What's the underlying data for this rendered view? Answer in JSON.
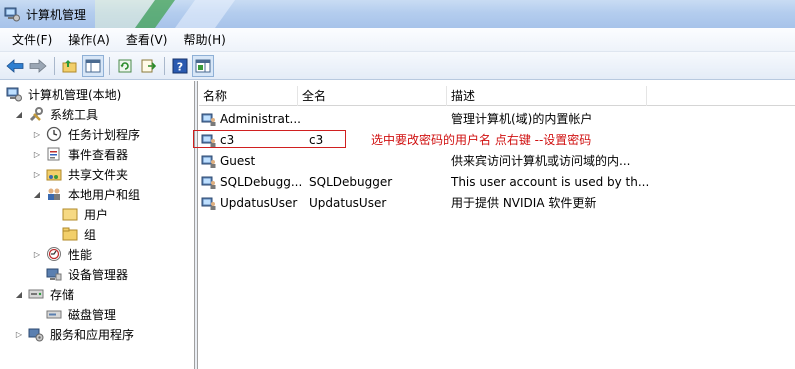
{
  "window": {
    "title": "计算机管理"
  },
  "menu": [
    "文件(F)",
    "操作(A)",
    "查看(V)",
    "帮助(H)"
  ],
  "toolbar": {
    "icons": [
      "back-arrow-icon",
      "forward-arrow-icon",
      "up-folder-icon",
      "show-tree-icon",
      "refresh-icon",
      "export-icon",
      "help-icon",
      "action-pane-icon"
    ]
  },
  "tree": {
    "root": "计算机管理(本地)",
    "system_tools": "系统工具",
    "task_scheduler": "任务计划程序",
    "event_viewer": "事件查看器",
    "shared_folders": "共享文件夹",
    "local_users_groups": "本地用户和组",
    "users": "用户",
    "groups": "组",
    "performance": "性能",
    "device_manager": "设备管理器",
    "storage": "存储",
    "disk_management": "磁盘管理",
    "services_apps": "服务和应用程序"
  },
  "list": {
    "columns": {
      "name": "名称",
      "full_name": "全名",
      "description": "描述"
    },
    "rows": [
      {
        "name": "Administrat...",
        "full_name": "",
        "description": "管理计算机(域)的内置帐户"
      },
      {
        "name": "c3",
        "full_name": "c3",
        "description": ""
      },
      {
        "name": "Guest",
        "full_name": "",
        "description": "供来宾访问计算机或访问域的内..."
      },
      {
        "name": "SQLDebugg...",
        "full_name": "SQLDebugger",
        "description": "This user account is used by th..."
      },
      {
        "name": "UpdatusUser",
        "full_name": "UpdatusUser",
        "description": "用于提供 NVIDIA 软件更新"
      }
    ]
  },
  "annotation": "选中要改密码的用户名  点右键  --设置密码",
  "colors": {
    "annotation": "#d01010",
    "titlebar": "#b4cdee"
  }
}
